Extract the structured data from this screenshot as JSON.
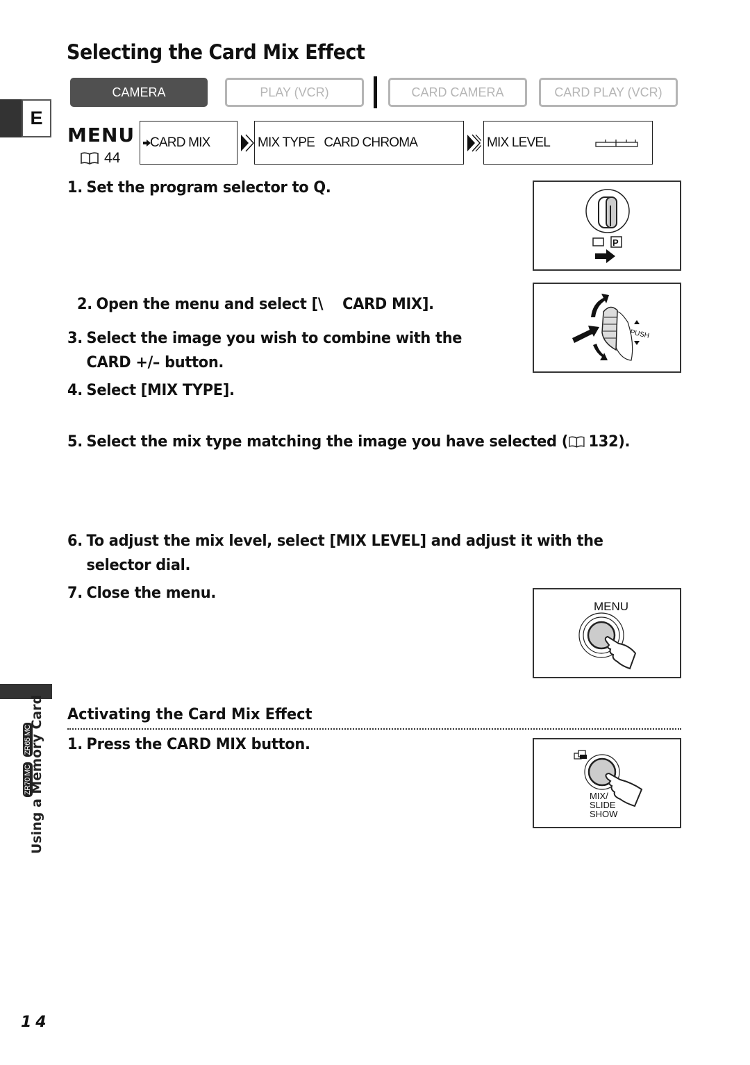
{
  "header": {
    "title": "Selecting the Card Mix Effect",
    "language_tab": "E"
  },
  "modes": [
    {
      "label": "CAMERA",
      "active": true
    },
    {
      "label": "PLAY (VCR)",
      "active": false
    },
    {
      "label": "CARD CAMERA",
      "active": false
    },
    {
      "label": "CARD PLAY (VCR)",
      "active": false
    }
  ],
  "menu_path": {
    "menu_label": "MENU",
    "page_ref": "44",
    "boxes": [
      {
        "text": "CARD MIX",
        "icon": "card-mix-arrow-icon"
      },
      {
        "text": "MIX TYPE   CARD CHROMA"
      },
      {
        "text": "MIX LEVEL",
        "icon": "level-bar-icon"
      }
    ]
  },
  "steps": [
    {
      "num": "1.",
      "text": "Set the program selector to Q."
    },
    {
      "num": "2.",
      "text": "Open the menu and select [\\    CARD MIX]."
    },
    {
      "num": "3.",
      "text": "Select the image you wish to combine with the",
      "cont": "CARD +/– button."
    },
    {
      "num": "4.",
      "text": "Select [MIX TYPE]."
    },
    {
      "num": "5.",
      "text": "Select the mix type matching the image you have selected (",
      "ref": "132",
      "tail": ")."
    },
    {
      "num": "6.",
      "text": "To adjust the mix level, select [MIX LEVEL] and adjust it with the",
      "cont": "selector dial."
    },
    {
      "num": "7.",
      "text": "Close the menu."
    }
  ],
  "figures": {
    "program_selector": {
      "label_p": "P"
    },
    "selector_dial": {
      "label": "PUSH"
    },
    "menu_button": {
      "label": "MENU"
    },
    "mix_button": {
      "label_line1": "MIX/",
      "label_line2": "SLIDE",
      "label_line3": "SHOW"
    }
  },
  "activating": {
    "title": "Activating the Card Mix Effect",
    "steps": [
      {
        "num": "1.",
        "text": "Press the CARD MIX button."
      }
    ]
  },
  "sidebar": {
    "section": "Using a Memory Card",
    "models": [
      "ZR70 MC",
      "ZR65 MC"
    ]
  },
  "footer": {
    "page_number": "14"
  }
}
